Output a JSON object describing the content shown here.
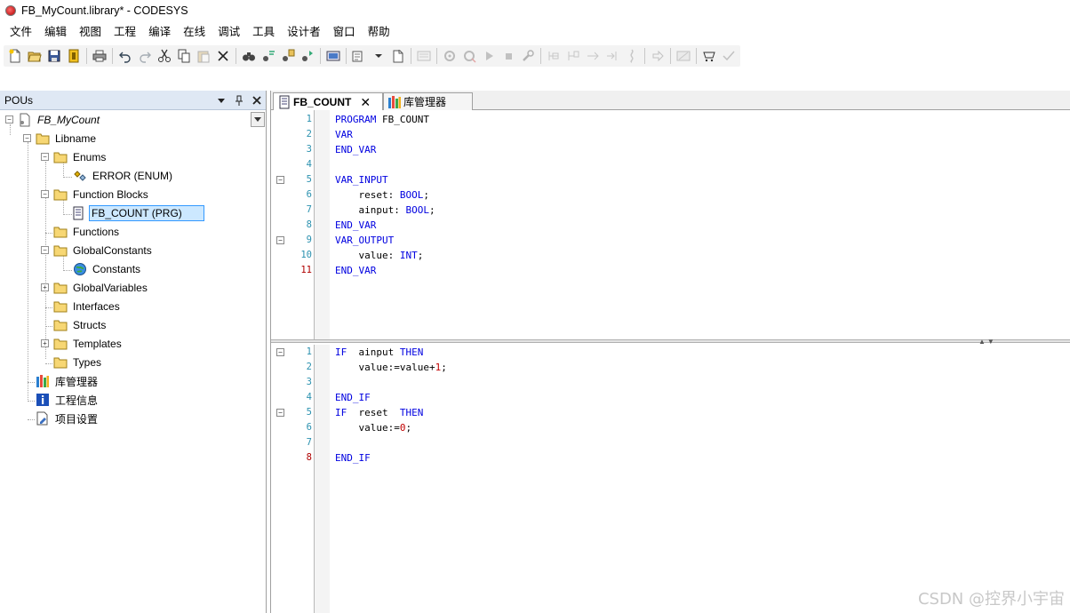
{
  "window": {
    "title": "FB_MyCount.library* - CODESYS"
  },
  "menu": [
    "文件",
    "编辑",
    "视图",
    "工程",
    "编译",
    "在线",
    "调试",
    "工具",
    "设计者",
    "窗口",
    "帮助"
  ],
  "pou_panel": {
    "title": "POUs",
    "tree": {
      "root": "FB_MyCount",
      "libname": "Libname",
      "enums": "Enums",
      "error_enum": "ERROR (ENUM)",
      "function_blocks": "Function Blocks",
      "fb_count": "FB_COUNT (PRG)",
      "functions": "Functions",
      "global_constants": "GlobalConstants",
      "constants": "Constants",
      "global_variables": "GlobalVariables",
      "interfaces": "Interfaces",
      "structs": "Structs",
      "templates": "Templates",
      "types": "Types",
      "library_manager": "库管理器",
      "project_info": "工程信息",
      "project_settings": "项目设置"
    }
  },
  "tabs": [
    {
      "label": "FB_COUNT",
      "active": true
    },
    {
      "label": "库管理器",
      "active": false
    }
  ],
  "declaration": [
    {
      "n": "1",
      "text": "PROGRAM FB_COUNT"
    },
    {
      "n": "2",
      "text": "VAR"
    },
    {
      "n": "3",
      "text": "END_VAR"
    },
    {
      "n": "4",
      "text": ""
    },
    {
      "n": "5",
      "text": "VAR_INPUT"
    },
    {
      "n": "6",
      "text": "    reset: BOOL;"
    },
    {
      "n": "7",
      "text": "    ainput: BOOL;"
    },
    {
      "n": "8",
      "text": "END_VAR"
    },
    {
      "n": "9",
      "text": "VAR_OUTPUT"
    },
    {
      "n": "10",
      "text": "    value: INT;"
    },
    {
      "n": "11",
      "text": "END_VAR"
    }
  ],
  "implementation": [
    {
      "n": "1",
      "text": "IF  ainput THEN"
    },
    {
      "n": "2",
      "text": "    value:=value+1;"
    },
    {
      "n": "3",
      "text": ""
    },
    {
      "n": "4",
      "text": "END_IF"
    },
    {
      "n": "5",
      "text": "IF  reset  THEN"
    },
    {
      "n": "6",
      "text": "    value:=0;"
    },
    {
      "n": "7",
      "text": ""
    },
    {
      "n": "8",
      "text": "END_IF"
    }
  ],
  "watermark": "CSDN @控界小宇宙"
}
